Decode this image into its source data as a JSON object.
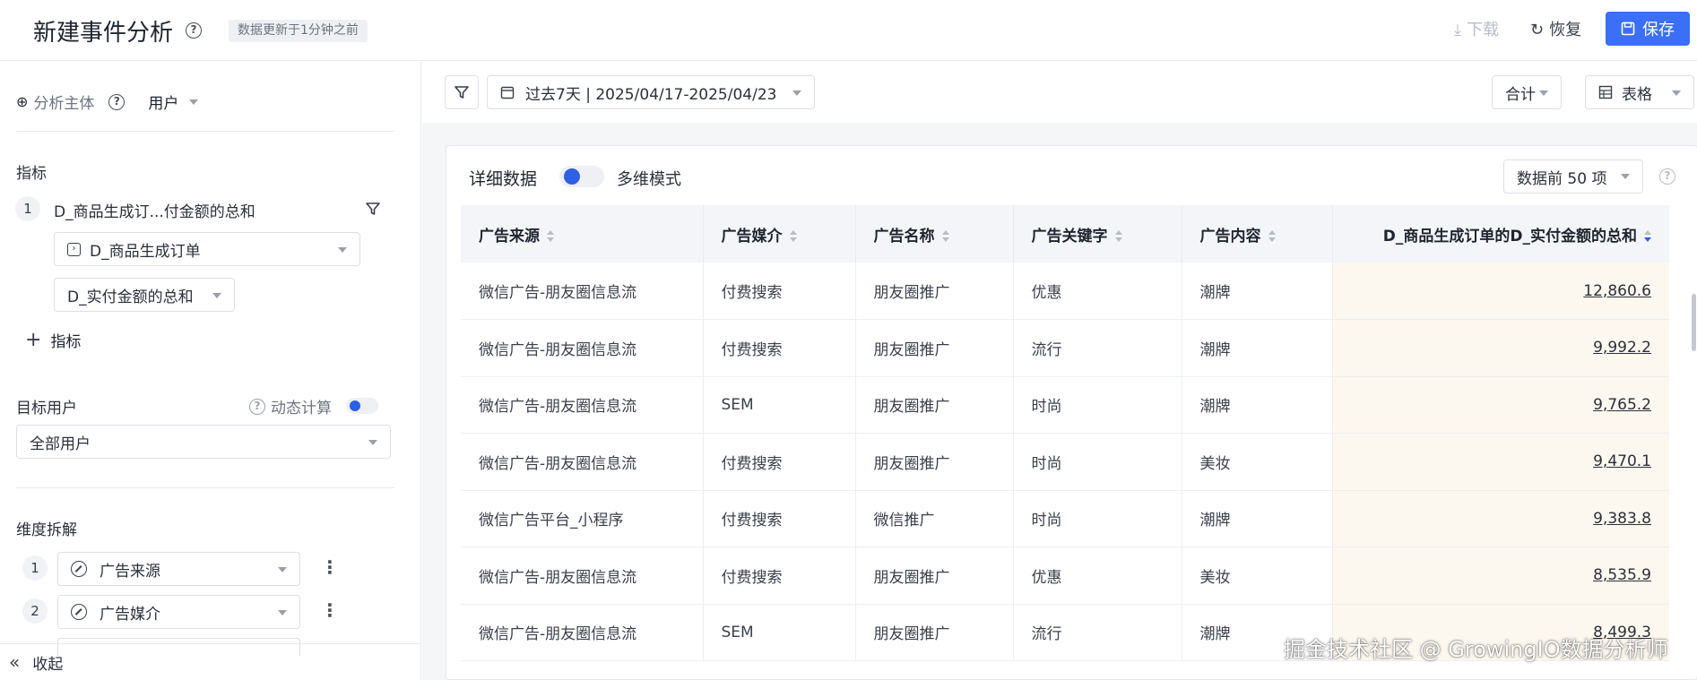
{
  "header": {
    "title": "新建事件分析",
    "update_badge": "数据更新于1分钟之前",
    "download_label": "下载",
    "restore_label": "恢复",
    "save_label": "保存"
  },
  "left_panel": {
    "subject_label": "分析主体",
    "subject_value": "用户",
    "metrics_label": "指标",
    "metric": {
      "index": "1",
      "name": "D_商品生成订...付金额的总和",
      "event": "D_商品生成订单",
      "aggregation": "D_实付金额的总和"
    },
    "add_metric_label": "指标",
    "target_users_label": "目标用户",
    "dynamic_calc_label": "动态计算",
    "target_users_value": "全部用户",
    "dimensions_label": "维度拆解",
    "dimensions": [
      {
        "index": "1",
        "label": "广告来源"
      },
      {
        "index": "2",
        "label": "广告媒介"
      }
    ],
    "collapse_label": "收起"
  },
  "toolbar": {
    "date_range": "过去7天 | 2025/04/17-2025/04/23",
    "total_label": "合计",
    "view_label": "表格"
  },
  "detail": {
    "title": "详细数据",
    "multi_dim_label": "多维模式",
    "top_n_label": "数据前 50 项"
  },
  "table": {
    "columns": [
      "广告来源",
      "广告媒介",
      "广告名称",
      "广告关键字",
      "广告内容",
      "D_商品生成订单的D_实付金额的总和"
    ],
    "rows": [
      [
        "微信广告-朋友圈信息流",
        "付费搜索",
        "朋友圈推广",
        "优惠",
        "潮牌",
        "12,860.6"
      ],
      [
        "微信广告-朋友圈信息流",
        "付费搜索",
        "朋友圈推广",
        "流行",
        "潮牌",
        "9,992.2"
      ],
      [
        "微信广告-朋友圈信息流",
        "SEM",
        "朋友圈推广",
        "时尚",
        "潮牌",
        "9,765.2"
      ],
      [
        "微信广告-朋友圈信息流",
        "付费搜索",
        "朋友圈推广",
        "时尚",
        "美妆",
        "9,470.1"
      ],
      [
        "微信广告平台_小程序",
        "付费搜索",
        "微信推广",
        "时尚",
        "潮牌",
        "9,383.8"
      ],
      [
        "微信广告-朋友圈信息流",
        "付费搜索",
        "朋友圈推广",
        "优惠",
        "美妆",
        "8,535.9"
      ],
      [
        "微信广告-朋友圈信息流",
        "SEM",
        "朋友圈推广",
        "流行",
        "潮牌",
        "8,499.3"
      ]
    ]
  },
  "watermark": "掘金技术社区 @ GrowingIO数据分析师",
  "colors": {
    "accent": "#3b6ff5",
    "highlight_col": "#fdf8ef"
  }
}
